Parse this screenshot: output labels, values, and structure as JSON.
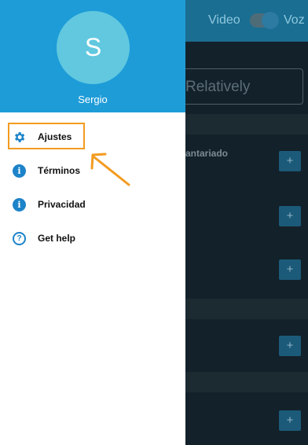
{
  "background_app": {
    "toggle_left_label": "Video",
    "toggle_right_label": "Voz",
    "search_text": "Relatively",
    "section_title": "antariado",
    "plus_label": "+"
  },
  "drawer": {
    "avatar_initial": "S",
    "user_name": "Sergio",
    "items": [
      {
        "label": "Ajustes",
        "icon": "gear-icon"
      },
      {
        "label": "Términos",
        "icon": "info-icon"
      },
      {
        "label": "Privacidad",
        "icon": "info-icon"
      },
      {
        "label": "Get help",
        "icon": "help-circle-icon"
      }
    ]
  },
  "colors": {
    "header_blue": "#1e9cd8",
    "avatar": "#61c8df",
    "icon_blue": "#1c83c9",
    "highlight": "#f39b20"
  }
}
